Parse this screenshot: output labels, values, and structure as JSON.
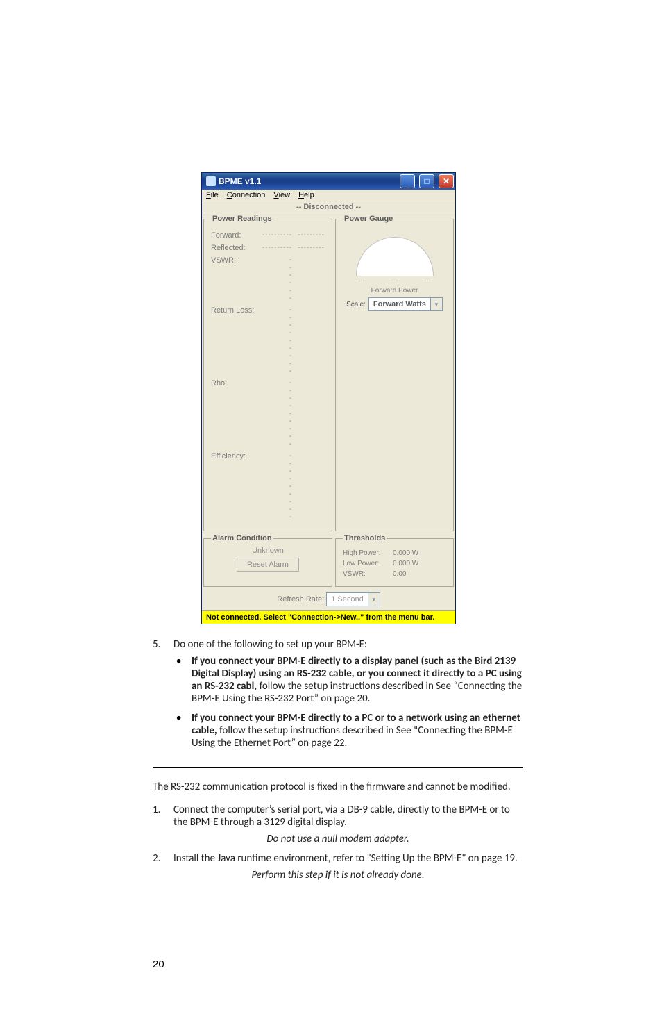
{
  "app": {
    "title": "BPME v1.1",
    "menu": {
      "file": "File",
      "connection": "Connection",
      "view": "View",
      "help": "Help"
    },
    "status_top": "-- Disconnected --",
    "panels": {
      "power_readings": {
        "legend": "Power Readings",
        "rows": {
          "forward_label": "Forward:",
          "reflected_label": "Reflected:",
          "vswr_label": "VSWR:",
          "return_loss_label": "Return Loss:",
          "rho_label": "Rho:",
          "efficiency_label": "Efficiency:"
        }
      },
      "power_gauge": {
        "legend": "Power Gauge",
        "caption": "Forward Power",
        "scale_label": "Scale:",
        "scale_value": "Forward Watts"
      },
      "alarm": {
        "legend": "Alarm Condition",
        "status": "Unknown",
        "button": "Reset Alarm"
      },
      "thresholds": {
        "legend": "Thresholds",
        "high_power_label": "High Power:",
        "high_power_value": "0.000 W",
        "low_power_label": "Low Power:",
        "low_power_value": "0.000 W",
        "vswr_label": "VSWR:",
        "vswr_value": "0.00"
      }
    },
    "refresh": {
      "label": "Refresh Rate:",
      "value": "1 Second"
    },
    "statusbar": "Not connected. Select \"Connection->New..\" from the menu bar."
  },
  "doc": {
    "step5_num": "5.",
    "step5_text": "Do one of the following to set up your BPM-E:",
    "bullets": {
      "b1_bold": "If you connect your BPM-E directly to a display panel (such as the Bird 2139 Digital Display) using an RS-232 cable, or you connect it directly to a PC using an RS-232 cabl,",
      "b1_rest": " follow the setup instructions described in See “Connecting the BPM-E Using the RS-232 Port” on page 20.",
      "b2_bold": "If you connect your BPM-E directly to a PC or to a network using an ethernet cable,",
      "b2_rest": " follow the setup instructions described in See “Connecting the BPM-E Using the Ethernet Port” on page 22."
    },
    "para_rs232": "The RS-232 communication protocol is fixed in the firmware and cannot be modified.",
    "step1_num": "1.",
    "step1_text": "Connect the computer’s serial port, via a DB-9 cable, directly to the BPM-E or to the BPM-E through a 3129 digital display.",
    "note1": "Do not use a null modem adapter.",
    "step2_num": "2.",
    "step2_text": "Install the Java runtime environment, refer to \"Setting Up the BPM-E\" on page 19.",
    "note2": "Perform this step if it is not already done.",
    "page_number": "20"
  }
}
